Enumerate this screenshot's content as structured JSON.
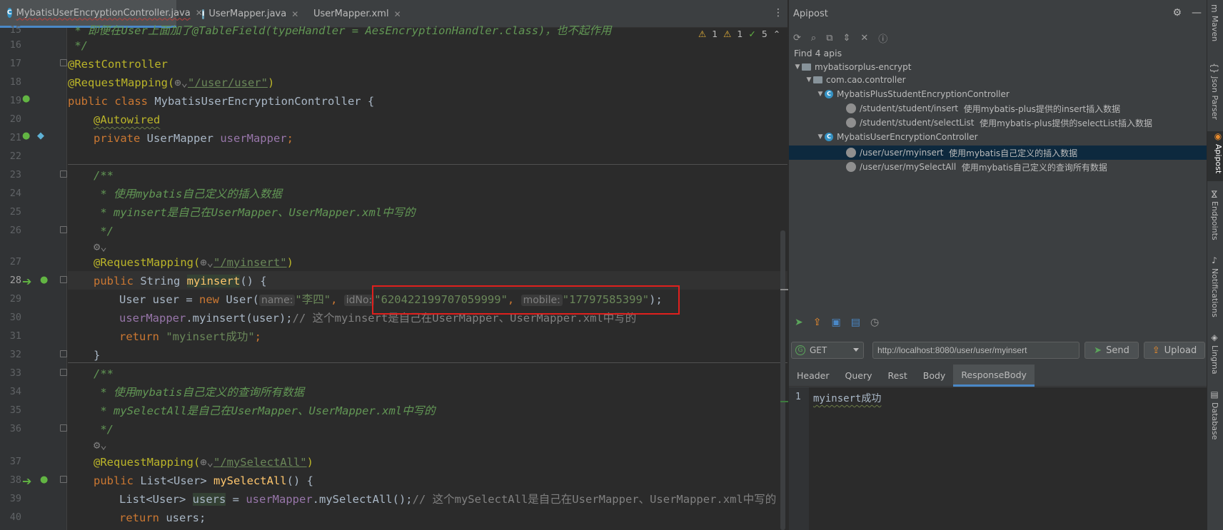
{
  "editor_tabs": [
    {
      "label": "MybatisUserEncryptionController.java",
      "icon": "class-icon",
      "active": true
    },
    {
      "label": "UserMapper.java",
      "icon": "interface-icon",
      "active": false
    },
    {
      "label": "UserMapper.xml",
      "icon": "xml-icon",
      "active": false
    }
  ],
  "inspections": {
    "warnings": "1",
    "weak_warnings": "1",
    "typos": "5"
  },
  "code": {
    "line_numbers": [
      "15",
      "16",
      "17",
      "18",
      "19",
      "20",
      "21",
      "22",
      "23",
      "24",
      "25",
      "26",
      "27",
      "28",
      "29",
      "30",
      "31",
      "32",
      "33",
      "34",
      "35",
      "36",
      "37",
      "38",
      "39",
      "40"
    ],
    "l15_comment": " * 即便在User上面加了@TableField(typeHandler = AesEncryptionHandler.class)，也不起作用",
    "l16": " */",
    "l17_anno": "@RestController",
    "l18_anno": "@RequestMapping(",
    "l18_path": "\"/user/user\"",
    "l18_close": ")",
    "l19_public": "public class",
    "l19_name": " MybatisUserEncryptionController {",
    "l20_anno": "@Autowired",
    "l21_kw": "private",
    "l21_type": " UserMapper ",
    "l21_field": "userMapper",
    "l21_semi": ";",
    "l23": "/**",
    "l24": " * 使用mybatis自己定义的插入数据",
    "l25": " * myinsert是自己在UserMapper、UserMapper.xml中写的",
    "l26": " */",
    "l27_anno": "@RequestMapping(",
    "l27_path": "\"/myinsert\"",
    "l27_close": ")",
    "l28_kw": "public",
    "l28_type": " String ",
    "l28_method": "myinsert",
    "l28_rest": "() {",
    "l29_a": "User user = ",
    "l29_new": "new",
    "l29_b": " User(",
    "l29_hint1": "name:",
    "l29_s1": "\"李四\"",
    "l29_c1": ", ",
    "l29_hint2": "idNo:",
    "l29_s2": "\"620422199707059999\"",
    "l29_c2": ", ",
    "l29_hint3": "mobile:",
    "l29_s3": "\"17797585399\"",
    "l29_end": ");",
    "l30_a": "userMapper",
    "l30_b": ".myinsert(user);",
    "l30_cm": "// 这个myinsert是自己在UserMapper、UserMapper.xml中写的",
    "l31_kw": "return",
    "l31_str": " \"myinsert成功\"",
    "l31_semi": ";",
    "l32": "}",
    "l33": "/**",
    "l34": " * 使用mybatis自己定义的查询所有数据",
    "l35": " * mySelectAll是自己在UserMapper、UserMapper.xml中写的",
    "l36": " */",
    "l37_anno": "@RequestMapping(",
    "l37_path": "\"/mySelectAll\"",
    "l37_close": ")",
    "l38_kw": "public",
    "l38_type": " List<User> ",
    "l38_method": "mySelectAll",
    "l38_rest": "() {",
    "l39_a": "List<User> ",
    "l39_users": "users",
    "l39_b": " = ",
    "l39_mapper": "userMapper",
    "l39_c": ".mySelectAll();",
    "l39_cm": "// 这个mySelectAll是自己在UserMapper、UserMapper.xml中写的",
    "l40_kw": "return",
    "l40_rest": " users;"
  },
  "apipost": {
    "title": "Apipost",
    "find_text": "Find 4 apis",
    "tree": [
      {
        "label": "mybatisorplus-encrypt",
        "desc": ""
      },
      {
        "label": "com.cao.controller",
        "desc": ""
      },
      {
        "label": "MybatisPlusStudentEncryptionController",
        "desc": ""
      },
      {
        "label": "/student/student/insert",
        "desc": "使用mybatis-plus提供的insert插入数据"
      },
      {
        "label": "/student/student/selectList",
        "desc": "使用mybatis-plus提供的selectList插入数据"
      },
      {
        "label": "MybatisUserEncryptionController",
        "desc": ""
      },
      {
        "label": "/user/user/myinsert",
        "desc": "使用mybatis自己定义的插入数据"
      },
      {
        "label": "/user/user/mySelectAll",
        "desc": "使用mybatis自己定义的查询所有数据"
      }
    ],
    "method": "GET",
    "url": "http://localhost:8080/user/user/myinsert",
    "send_label": "Send",
    "upload_label": "Upload",
    "tabs": [
      "Header",
      "Query",
      "Rest",
      "Body",
      "ResponseBody"
    ],
    "active_tab": "ResponseBody",
    "response_line": "1",
    "response_text": "myinsert成功"
  },
  "stripe": [
    "Maven",
    "Json Parser",
    "Apipost",
    "Endpoints",
    "Notifications",
    "Lingma",
    "Database"
  ],
  "colors": {
    "accent": "#4a88c7",
    "highlight_box": "#e0201d",
    "string": "#6a8759",
    "keyword": "#cc7832"
  }
}
